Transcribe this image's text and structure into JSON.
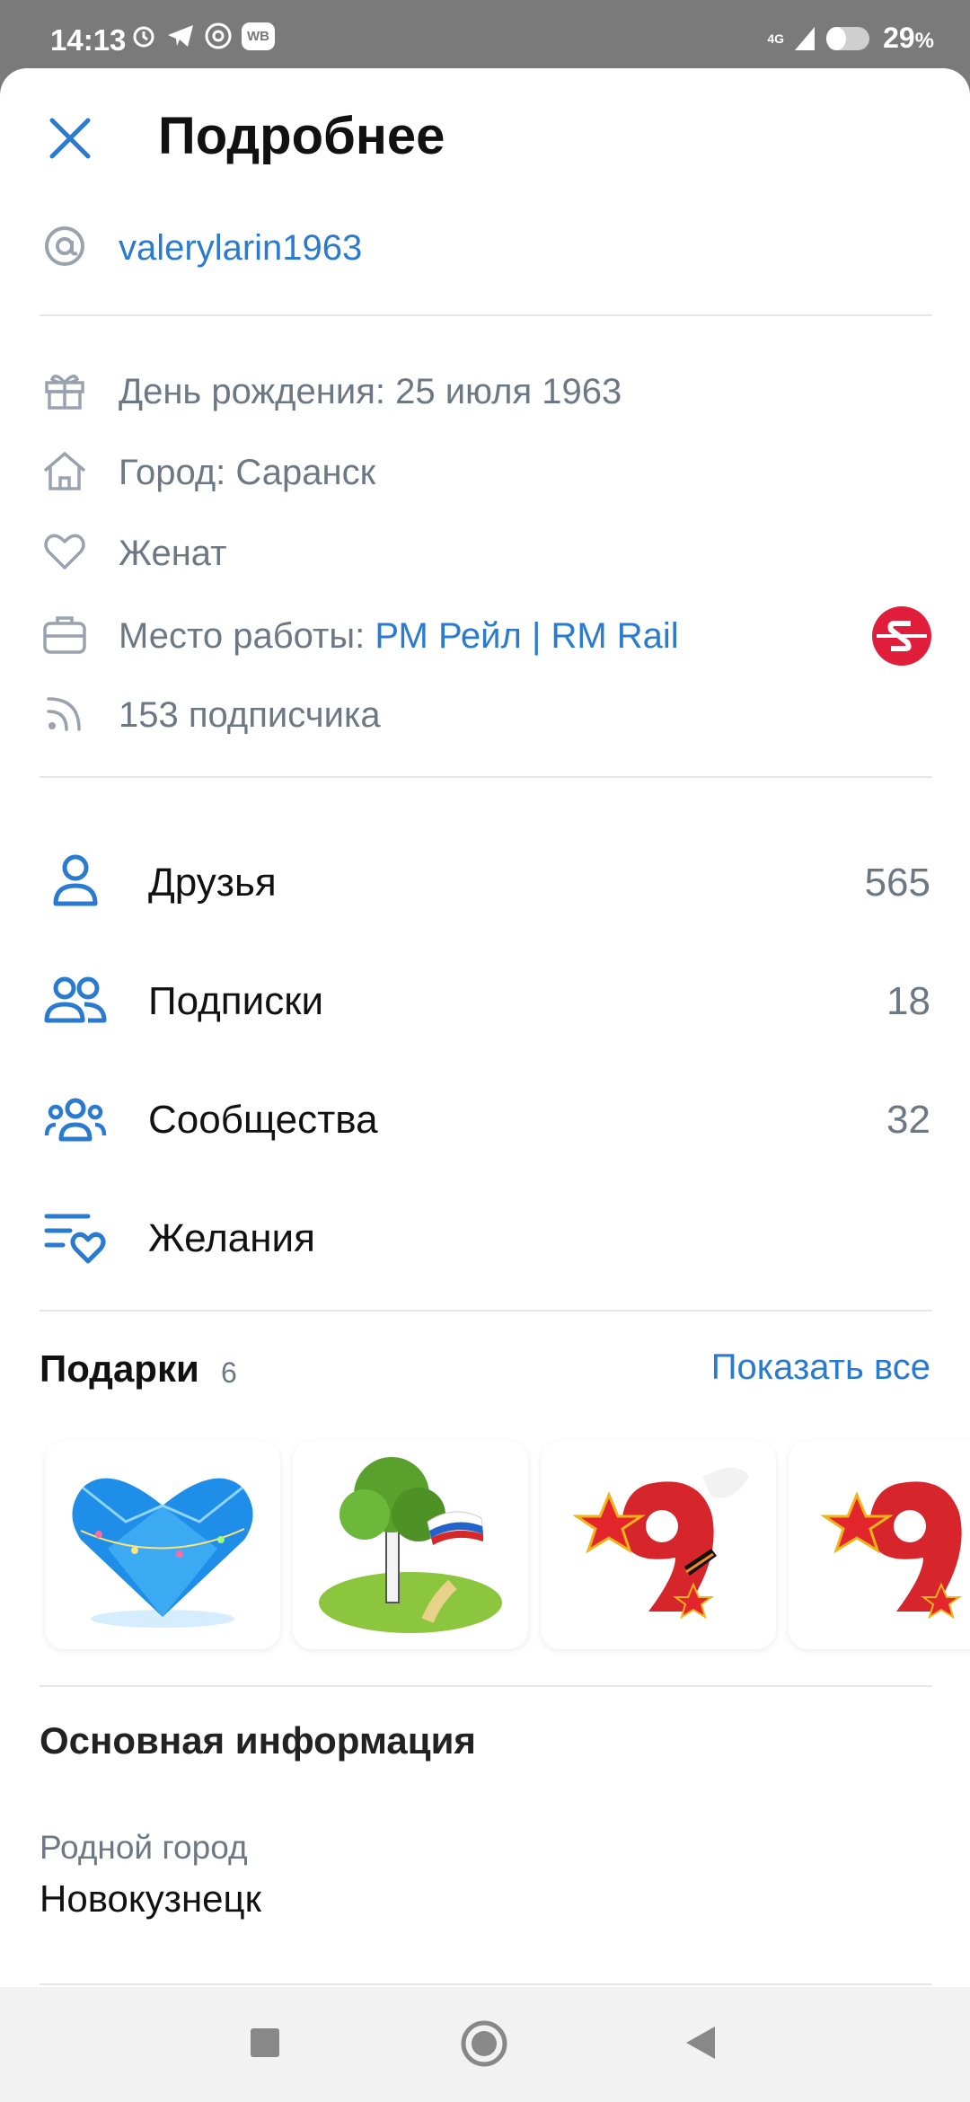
{
  "status": {
    "time": "14:13",
    "wb": "WB",
    "network": "4G",
    "battery": "29",
    "battery_unit": "%"
  },
  "header": {
    "title": "Подробнее"
  },
  "username": "valerylarin1963",
  "info": {
    "birthday": "День рождения: 25 июля 1963",
    "city": "Город: Саранск",
    "status": "Женат",
    "work_label": "Место работы: ",
    "work_value": "РМ Рейл | RM Rail",
    "subscribers": "153 подписчика"
  },
  "nav": [
    {
      "label": "Друзья",
      "count": "565",
      "icon": "person-icon"
    },
    {
      "label": "Подписки",
      "count": "18",
      "icon": "people-icon"
    },
    {
      "label": "Сообщества",
      "count": "32",
      "icon": "community-icon"
    },
    {
      "label": "Желания",
      "count": "",
      "icon": "wishlist-icon"
    }
  ],
  "gifts": {
    "title": "Подарки",
    "count": "6",
    "show_all": "Показать все"
  },
  "basic": {
    "title": "Основная информация",
    "hometown_label": "Родной город",
    "hometown_value": "Новокузнецк"
  },
  "colors": {
    "accent": "#2a7bd0",
    "text_secondary": "#6d7885",
    "work_logo": "#e01e3c"
  }
}
